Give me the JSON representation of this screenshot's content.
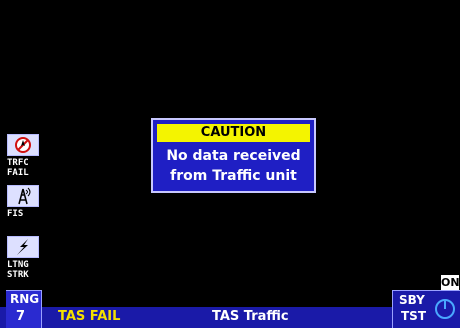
{
  "caution": {
    "title": "CAUTION",
    "line1": "No data received",
    "line2": "from Traffic unit"
  },
  "sidebar": {
    "items": [
      {
        "label1": "TRFC",
        "label2": "FAIL",
        "icon": "traffic-fail-icon"
      },
      {
        "label1": "FIS",
        "label2": "",
        "icon": "fis-tower-icon"
      },
      {
        "label1": "LTNG",
        "label2": "STRK",
        "icon": "lightning-icon"
      }
    ]
  },
  "bottom": {
    "rng_label": "RNG",
    "rng_value": "7",
    "status_fail": "TAS FAIL",
    "page_title": "TAS Traffic",
    "mode_line1": "SBY",
    "mode_line2": "TST",
    "on_badge": "ON"
  },
  "colors": {
    "background": "#000000",
    "panel_blue": "#1f1fc4",
    "caution_yellow": "#f4f400",
    "status_yellow": "#f4e000"
  }
}
